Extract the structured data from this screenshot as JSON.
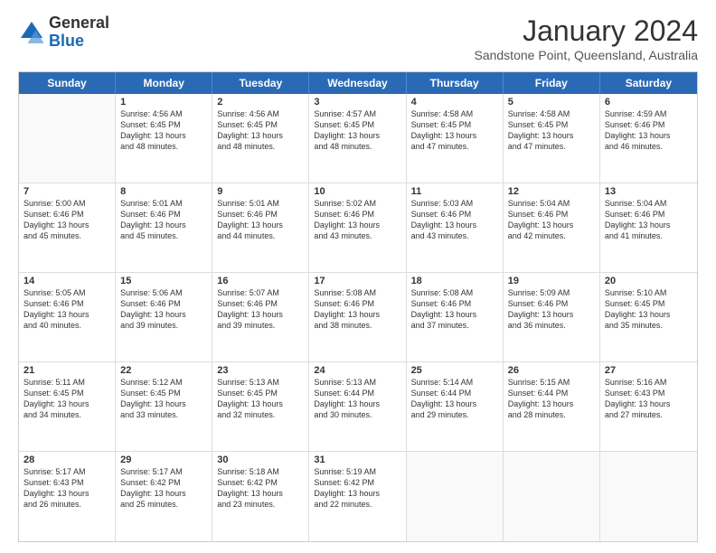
{
  "logo": {
    "general": "General",
    "blue": "Blue"
  },
  "title": "January 2024",
  "subtitle": "Sandstone Point, Queensland, Australia",
  "days": [
    "Sunday",
    "Monday",
    "Tuesday",
    "Wednesday",
    "Thursday",
    "Friday",
    "Saturday"
  ],
  "weeks": [
    [
      {
        "day": "",
        "empty": true
      },
      {
        "day": "1",
        "sunrise": "Sunrise: 4:56 AM",
        "sunset": "Sunset: 6:45 PM",
        "daylight": "Daylight: 13 hours",
        "minutes": "and 48 minutes."
      },
      {
        "day": "2",
        "sunrise": "Sunrise: 4:56 AM",
        "sunset": "Sunset: 6:45 PM",
        "daylight": "Daylight: 13 hours",
        "minutes": "and 48 minutes."
      },
      {
        "day": "3",
        "sunrise": "Sunrise: 4:57 AM",
        "sunset": "Sunset: 6:45 PM",
        "daylight": "Daylight: 13 hours",
        "minutes": "and 48 minutes."
      },
      {
        "day": "4",
        "sunrise": "Sunrise: 4:58 AM",
        "sunset": "Sunset: 6:45 PM",
        "daylight": "Daylight: 13 hours",
        "minutes": "and 47 minutes."
      },
      {
        "day": "5",
        "sunrise": "Sunrise: 4:58 AM",
        "sunset": "Sunset: 6:45 PM",
        "daylight": "Daylight: 13 hours",
        "minutes": "and 47 minutes."
      },
      {
        "day": "6",
        "sunrise": "Sunrise: 4:59 AM",
        "sunset": "Sunset: 6:46 PM",
        "daylight": "Daylight: 13 hours",
        "minutes": "and 46 minutes."
      }
    ],
    [
      {
        "day": "7",
        "sunrise": "Sunrise: 5:00 AM",
        "sunset": "Sunset: 6:46 PM",
        "daylight": "Daylight: 13 hours",
        "minutes": "and 45 minutes."
      },
      {
        "day": "8",
        "sunrise": "Sunrise: 5:01 AM",
        "sunset": "Sunset: 6:46 PM",
        "daylight": "Daylight: 13 hours",
        "minutes": "and 45 minutes."
      },
      {
        "day": "9",
        "sunrise": "Sunrise: 5:01 AM",
        "sunset": "Sunset: 6:46 PM",
        "daylight": "Daylight: 13 hours",
        "minutes": "and 44 minutes."
      },
      {
        "day": "10",
        "sunrise": "Sunrise: 5:02 AM",
        "sunset": "Sunset: 6:46 PM",
        "daylight": "Daylight: 13 hours",
        "minutes": "and 43 minutes."
      },
      {
        "day": "11",
        "sunrise": "Sunrise: 5:03 AM",
        "sunset": "Sunset: 6:46 PM",
        "daylight": "Daylight: 13 hours",
        "minutes": "and 43 minutes."
      },
      {
        "day": "12",
        "sunrise": "Sunrise: 5:04 AM",
        "sunset": "Sunset: 6:46 PM",
        "daylight": "Daylight: 13 hours",
        "minutes": "and 42 minutes."
      },
      {
        "day": "13",
        "sunrise": "Sunrise: 5:04 AM",
        "sunset": "Sunset: 6:46 PM",
        "daylight": "Daylight: 13 hours",
        "minutes": "and 41 minutes."
      }
    ],
    [
      {
        "day": "14",
        "sunrise": "Sunrise: 5:05 AM",
        "sunset": "Sunset: 6:46 PM",
        "daylight": "Daylight: 13 hours",
        "minutes": "and 40 minutes."
      },
      {
        "day": "15",
        "sunrise": "Sunrise: 5:06 AM",
        "sunset": "Sunset: 6:46 PM",
        "daylight": "Daylight: 13 hours",
        "minutes": "and 39 minutes."
      },
      {
        "day": "16",
        "sunrise": "Sunrise: 5:07 AM",
        "sunset": "Sunset: 6:46 PM",
        "daylight": "Daylight: 13 hours",
        "minutes": "and 39 minutes."
      },
      {
        "day": "17",
        "sunrise": "Sunrise: 5:08 AM",
        "sunset": "Sunset: 6:46 PM",
        "daylight": "Daylight: 13 hours",
        "minutes": "and 38 minutes."
      },
      {
        "day": "18",
        "sunrise": "Sunrise: 5:08 AM",
        "sunset": "Sunset: 6:46 PM",
        "daylight": "Daylight: 13 hours",
        "minutes": "and 37 minutes."
      },
      {
        "day": "19",
        "sunrise": "Sunrise: 5:09 AM",
        "sunset": "Sunset: 6:46 PM",
        "daylight": "Daylight: 13 hours",
        "minutes": "and 36 minutes."
      },
      {
        "day": "20",
        "sunrise": "Sunrise: 5:10 AM",
        "sunset": "Sunset: 6:45 PM",
        "daylight": "Daylight: 13 hours",
        "minutes": "and 35 minutes."
      }
    ],
    [
      {
        "day": "21",
        "sunrise": "Sunrise: 5:11 AM",
        "sunset": "Sunset: 6:45 PM",
        "daylight": "Daylight: 13 hours",
        "minutes": "and 34 minutes."
      },
      {
        "day": "22",
        "sunrise": "Sunrise: 5:12 AM",
        "sunset": "Sunset: 6:45 PM",
        "daylight": "Daylight: 13 hours",
        "minutes": "and 33 minutes."
      },
      {
        "day": "23",
        "sunrise": "Sunrise: 5:13 AM",
        "sunset": "Sunset: 6:45 PM",
        "daylight": "Daylight: 13 hours",
        "minutes": "and 32 minutes."
      },
      {
        "day": "24",
        "sunrise": "Sunrise: 5:13 AM",
        "sunset": "Sunset: 6:44 PM",
        "daylight": "Daylight: 13 hours",
        "minutes": "and 30 minutes."
      },
      {
        "day": "25",
        "sunrise": "Sunrise: 5:14 AM",
        "sunset": "Sunset: 6:44 PM",
        "daylight": "Daylight: 13 hours",
        "minutes": "and 29 minutes."
      },
      {
        "day": "26",
        "sunrise": "Sunrise: 5:15 AM",
        "sunset": "Sunset: 6:44 PM",
        "daylight": "Daylight: 13 hours",
        "minutes": "and 28 minutes."
      },
      {
        "day": "27",
        "sunrise": "Sunrise: 5:16 AM",
        "sunset": "Sunset: 6:43 PM",
        "daylight": "Daylight: 13 hours",
        "minutes": "and 27 minutes."
      }
    ],
    [
      {
        "day": "28",
        "sunrise": "Sunrise: 5:17 AM",
        "sunset": "Sunset: 6:43 PM",
        "daylight": "Daylight: 13 hours",
        "minutes": "and 26 minutes."
      },
      {
        "day": "29",
        "sunrise": "Sunrise: 5:17 AM",
        "sunset": "Sunset: 6:42 PM",
        "daylight": "Daylight: 13 hours",
        "minutes": "and 25 minutes."
      },
      {
        "day": "30",
        "sunrise": "Sunrise: 5:18 AM",
        "sunset": "Sunset: 6:42 PM",
        "daylight": "Daylight: 13 hours",
        "minutes": "and 23 minutes."
      },
      {
        "day": "31",
        "sunrise": "Sunrise: 5:19 AM",
        "sunset": "Sunset: 6:42 PM",
        "daylight": "Daylight: 13 hours",
        "minutes": "and 22 minutes."
      },
      {
        "day": "",
        "empty": true
      },
      {
        "day": "",
        "empty": true
      },
      {
        "day": "",
        "empty": true
      }
    ]
  ]
}
